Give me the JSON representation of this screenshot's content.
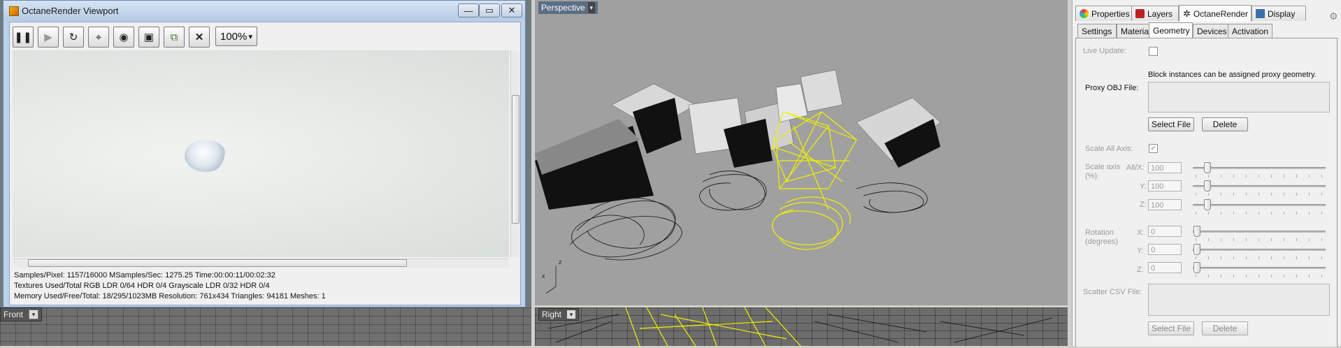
{
  "octane_window": {
    "title": "OctaneRender Viewport",
    "controls": {
      "minimize": "—",
      "maximize": "▭",
      "close": "✕"
    },
    "toolbar": {
      "buttons": [
        {
          "name": "pause-button",
          "icon": "pause-icon",
          "glyph": "❚❚"
        },
        {
          "name": "play-button",
          "icon": "play-icon",
          "glyph": "▶"
        },
        {
          "name": "restart-button",
          "icon": "restart-icon",
          "glyph": "↻"
        },
        {
          "name": "focus-picker-button",
          "icon": "focus-icon",
          "glyph": "⌖"
        },
        {
          "name": "material-picker-button",
          "icon": "material-icon",
          "glyph": "◉"
        },
        {
          "name": "camera-button",
          "icon": "camera-icon",
          "glyph": "▣"
        },
        {
          "name": "copy-render-button",
          "icon": "copy-icon",
          "glyph": "⧉"
        },
        {
          "name": "stop-button",
          "icon": "stop-icon",
          "glyph": "✕"
        }
      ],
      "zoom_value": "100%",
      "zoom_arrow": "▾"
    },
    "stats": {
      "line1": "Samples/Pixel: 1157/16000  MSamples/Sec: 1275.25  Time:00:00:11/00:02:32",
      "line2": "Textures Used/Total RGB LDR 0/64  HDR 0/4  Grayscale LDR 0/32  HDR 0/4",
      "line3": "Memory Used/Free/Total: 18/295/1023MB  Resolution: 761x434  Triangles: 94181  Meshes:  1"
    }
  },
  "viewports": {
    "perspective_label": "Perspective",
    "front_label": "Front",
    "right_label": "Right",
    "dropdown_glyph": "▾",
    "colors": {
      "selected_wire": "#f0f000",
      "wire": "#111111"
    },
    "axis_labels": {
      "x": "x",
      "z": "z"
    }
  },
  "panel": {
    "tabs": [
      "Properties",
      "Layers",
      "OctaneRender",
      "Display"
    ],
    "active_tab": "OctaneRender",
    "subtabs": [
      "Settings",
      "Materials",
      "Geometry",
      "Devices",
      "Activation"
    ],
    "active_subtab": "Geometry",
    "live_update_label": "Live Update:",
    "proxy_label": "Proxy OBJ File:",
    "proxy_hint": "Block instances can be assigned proxy geometry.",
    "select_file": "Select File",
    "delete": "Delete",
    "scale_all_label": "Scale All Axis:",
    "scale_all_check": "✓",
    "scale_axis_label": "Scale axis",
    "scale_axis_unit": "(%)",
    "scale_x_label": "All/X:",
    "scale_y_label": "Y:",
    "scale_z_label": "Z:",
    "scale_x": "100",
    "scale_y": "100",
    "scale_z": "100",
    "rotation_label": "Rotation",
    "rotation_unit": "(degrees)",
    "rot_x_label": "X:",
    "rot_y_label": "Y:",
    "rot_z_label": "Z:",
    "rot_x": "0",
    "rot_y": "0",
    "rot_z": "0",
    "scatter_label": "Scatter CSV File:",
    "select_file2": "Select File",
    "delete2": "Delete",
    "gear_glyph": "⚙"
  }
}
